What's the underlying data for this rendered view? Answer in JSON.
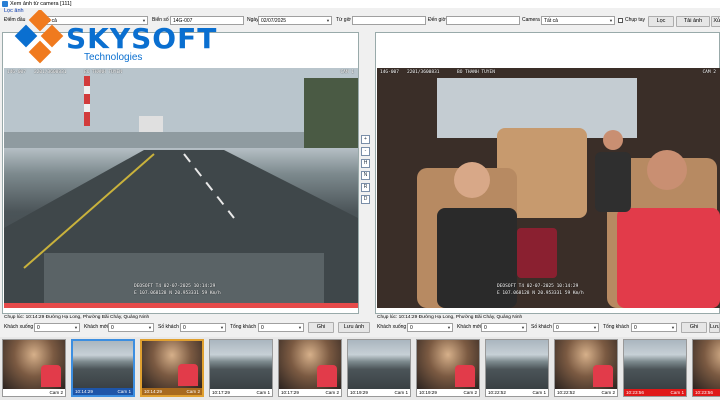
{
  "window": {
    "title": "Xem ảnh từ camera [111]"
  },
  "group": {
    "label": "Lọc ảnh"
  },
  "filters": {
    "device_label": "Điểm đầu",
    "device_value": "Tất cả",
    "plate_label": "Biển số",
    "plate_value": "14G-007",
    "date_label": "Ngày",
    "date_value": "02/07/2025",
    "from_label": "Từ giờ",
    "from_value": "",
    "to_label": "Đến giờ",
    "to_value": "",
    "camera_label": "Camera",
    "camera_value": "Tất cả",
    "manual_label": "Chụp tay",
    "filter_button": "Lọc",
    "load_button": "Tải ảnh",
    "extra_button": "Xử"
  },
  "logo": {
    "name": "SKYSOFT",
    "tagline": "Technologies"
  },
  "left_view": {
    "osd_top_left": "14G-007",
    "osd_top_id": "2201/3600831",
    "osd_top_driver": "BO THANH TUYEN",
    "osd_cam": "CAM 1",
    "osd_bottom_line1": "DEOSOFT  T4  02-07-2025  10:14:29",
    "osd_bottom_line2": "E 107.068128  N 20.953331  59 Km/h",
    "caption": "Chụp lúc: 10:14:29 Đường Hạ Long, Phường Bãi Cháy, Quảng Ninh",
    "counts": {
      "up_label": "Khách xuống",
      "up_value": "0",
      "new_label": "Khách mới",
      "new_value": "0",
      "count_label": "Số khách",
      "count_value": "0",
      "total_label": "Tổng khách",
      "total_value": "0",
      "save_button": "Ghi",
      "saveimg_button": "Lưu ảnh"
    }
  },
  "right_view": {
    "osd_top_left": "14G-007",
    "osd_top_id": "2201/3600831",
    "osd_top_driver": "BO THANH TUYEN",
    "osd_cam": "CAM 2",
    "osd_bottom_line1": "DEOSOFT  T4  02-07-2025  10:14:29",
    "osd_bottom_line2": "E 107.068128  N 20.953331  59 Km/h",
    "caption": "Chụp lúc: 10:14:29 Đường Hạ Long, Phường Bãi Cháy, Quảng Ninh",
    "counts": {
      "up_label": "Khách xuống",
      "up_value": "0",
      "new_label": "Khách mới",
      "new_value": "0",
      "count_label": "Số khách",
      "count_value": "0",
      "total_label": "Tổng khách",
      "total_value": "0",
      "save_button": "Ghi",
      "saveimg_button": "Lưu ảnh"
    }
  },
  "side_buttons": [
    "+",
    "-",
    "H",
    "N",
    "R",
    "D"
  ],
  "thumbnails": [
    {
      "time": "",
      "cam": "Cam 2",
      "kind": "interior",
      "state": "normal"
    },
    {
      "time": "10:14:29",
      "cam": "Cam 1",
      "kind": "road",
      "state": "selected"
    },
    {
      "time": "10:14:29",
      "cam": "Cam 2",
      "kind": "interior",
      "state": "selected2"
    },
    {
      "time": "10:17:29",
      "cam": "Cam 1",
      "kind": "road",
      "state": "normal"
    },
    {
      "time": "10:17:29",
      "cam": "Cam 2",
      "kind": "interior",
      "state": "normal"
    },
    {
      "time": "10:19:29",
      "cam": "Cam 1",
      "kind": "road",
      "state": "normal"
    },
    {
      "time": "10:19:29",
      "cam": "Cam 2",
      "kind": "interior",
      "state": "normal"
    },
    {
      "time": "10:22:52",
      "cam": "Cam 1",
      "kind": "road",
      "state": "normal"
    },
    {
      "time": "10:22:52",
      "cam": "Cam 2",
      "kind": "interior",
      "state": "normal"
    },
    {
      "time": "10:23:56",
      "cam": "Cam 1",
      "kind": "road",
      "state": "alarm"
    },
    {
      "time": "10:23:56",
      "cam": "Cam 2",
      "kind": "interior",
      "state": "alarm"
    }
  ],
  "colors": {
    "brand": "#0a6fd0",
    "logo_orange": "#f07a1e",
    "alarm": "#e01818",
    "selected": "#3c8ee0"
  }
}
